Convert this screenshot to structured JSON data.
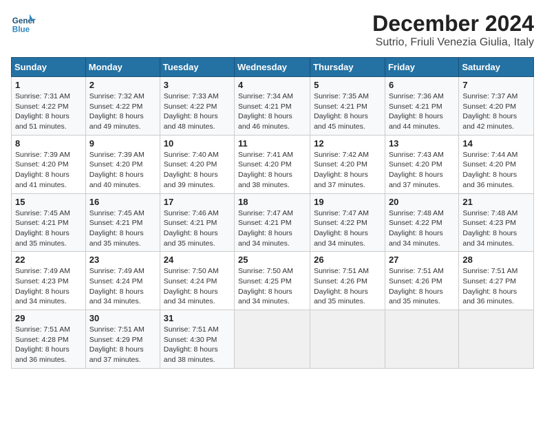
{
  "header": {
    "logo_line1": "General",
    "logo_line2": "Blue",
    "title": "December 2024",
    "subtitle": "Sutrio, Friuli Venezia Giulia, Italy"
  },
  "calendar": {
    "weekdays": [
      "Sunday",
      "Monday",
      "Tuesday",
      "Wednesday",
      "Thursday",
      "Friday",
      "Saturday"
    ],
    "weeks": [
      [
        {
          "day": "1",
          "info": "Sunrise: 7:31 AM\nSunset: 4:22 PM\nDaylight: 8 hours\nand 51 minutes."
        },
        {
          "day": "2",
          "info": "Sunrise: 7:32 AM\nSunset: 4:22 PM\nDaylight: 8 hours\nand 49 minutes."
        },
        {
          "day": "3",
          "info": "Sunrise: 7:33 AM\nSunset: 4:22 PM\nDaylight: 8 hours\nand 48 minutes."
        },
        {
          "day": "4",
          "info": "Sunrise: 7:34 AM\nSunset: 4:21 PM\nDaylight: 8 hours\nand 46 minutes."
        },
        {
          "day": "5",
          "info": "Sunrise: 7:35 AM\nSunset: 4:21 PM\nDaylight: 8 hours\nand 45 minutes."
        },
        {
          "day": "6",
          "info": "Sunrise: 7:36 AM\nSunset: 4:21 PM\nDaylight: 8 hours\nand 44 minutes."
        },
        {
          "day": "7",
          "info": "Sunrise: 7:37 AM\nSunset: 4:20 PM\nDaylight: 8 hours\nand 42 minutes."
        }
      ],
      [
        {
          "day": "8",
          "info": "Sunrise: 7:39 AM\nSunset: 4:20 PM\nDaylight: 8 hours\nand 41 minutes."
        },
        {
          "day": "9",
          "info": "Sunrise: 7:39 AM\nSunset: 4:20 PM\nDaylight: 8 hours\nand 40 minutes."
        },
        {
          "day": "10",
          "info": "Sunrise: 7:40 AM\nSunset: 4:20 PM\nDaylight: 8 hours\nand 39 minutes."
        },
        {
          "day": "11",
          "info": "Sunrise: 7:41 AM\nSunset: 4:20 PM\nDaylight: 8 hours\nand 38 minutes."
        },
        {
          "day": "12",
          "info": "Sunrise: 7:42 AM\nSunset: 4:20 PM\nDaylight: 8 hours\nand 37 minutes."
        },
        {
          "day": "13",
          "info": "Sunrise: 7:43 AM\nSunset: 4:20 PM\nDaylight: 8 hours\nand 37 minutes."
        },
        {
          "day": "14",
          "info": "Sunrise: 7:44 AM\nSunset: 4:20 PM\nDaylight: 8 hours\nand 36 minutes."
        }
      ],
      [
        {
          "day": "15",
          "info": "Sunrise: 7:45 AM\nSunset: 4:21 PM\nDaylight: 8 hours\nand 35 minutes."
        },
        {
          "day": "16",
          "info": "Sunrise: 7:45 AM\nSunset: 4:21 PM\nDaylight: 8 hours\nand 35 minutes."
        },
        {
          "day": "17",
          "info": "Sunrise: 7:46 AM\nSunset: 4:21 PM\nDaylight: 8 hours\nand 35 minutes."
        },
        {
          "day": "18",
          "info": "Sunrise: 7:47 AM\nSunset: 4:21 PM\nDaylight: 8 hours\nand 34 minutes."
        },
        {
          "day": "19",
          "info": "Sunrise: 7:47 AM\nSunset: 4:22 PM\nDaylight: 8 hours\nand 34 minutes."
        },
        {
          "day": "20",
          "info": "Sunrise: 7:48 AM\nSunset: 4:22 PM\nDaylight: 8 hours\nand 34 minutes."
        },
        {
          "day": "21",
          "info": "Sunrise: 7:48 AM\nSunset: 4:23 PM\nDaylight: 8 hours\nand 34 minutes."
        }
      ],
      [
        {
          "day": "22",
          "info": "Sunrise: 7:49 AM\nSunset: 4:23 PM\nDaylight: 8 hours\nand 34 minutes."
        },
        {
          "day": "23",
          "info": "Sunrise: 7:49 AM\nSunset: 4:24 PM\nDaylight: 8 hours\nand 34 minutes."
        },
        {
          "day": "24",
          "info": "Sunrise: 7:50 AM\nSunset: 4:24 PM\nDaylight: 8 hours\nand 34 minutes."
        },
        {
          "day": "25",
          "info": "Sunrise: 7:50 AM\nSunset: 4:25 PM\nDaylight: 8 hours\nand 34 minutes."
        },
        {
          "day": "26",
          "info": "Sunrise: 7:51 AM\nSunset: 4:26 PM\nDaylight: 8 hours\nand 35 minutes."
        },
        {
          "day": "27",
          "info": "Sunrise: 7:51 AM\nSunset: 4:26 PM\nDaylight: 8 hours\nand 35 minutes."
        },
        {
          "day": "28",
          "info": "Sunrise: 7:51 AM\nSunset: 4:27 PM\nDaylight: 8 hours\nand 36 minutes."
        }
      ],
      [
        {
          "day": "29",
          "info": "Sunrise: 7:51 AM\nSunset: 4:28 PM\nDaylight: 8 hours\nand 36 minutes."
        },
        {
          "day": "30",
          "info": "Sunrise: 7:51 AM\nSunset: 4:29 PM\nDaylight: 8 hours\nand 37 minutes."
        },
        {
          "day": "31",
          "info": "Sunrise: 7:51 AM\nSunset: 4:30 PM\nDaylight: 8 hours\nand 38 minutes."
        },
        {
          "day": "",
          "info": ""
        },
        {
          "day": "",
          "info": ""
        },
        {
          "day": "",
          "info": ""
        },
        {
          "day": "",
          "info": ""
        }
      ]
    ]
  }
}
